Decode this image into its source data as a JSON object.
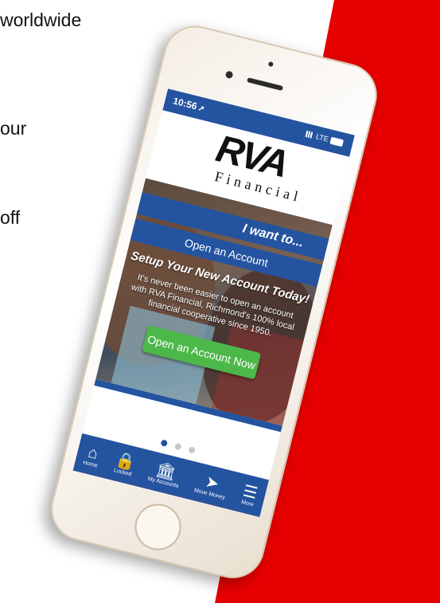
{
  "side_texts": [
    "worldwide",
    "our",
    "off"
  ],
  "status": {
    "time": "10:56",
    "nav_glyph": "➚",
    "network": "LTE"
  },
  "logo": {
    "main": "RVA",
    "sub": "Financial"
  },
  "hero": {
    "i_want_to": "I want to...",
    "option": "Open an Account",
    "title": "Setup Your New Account Today!",
    "body": "It's never been easier to open an account with RVA Financial, Richmond's 100% local financial cooperative since 1950.",
    "cta": "Open an Account Now"
  },
  "carousel": {
    "count": 3,
    "active_index": 0
  },
  "tabs": [
    {
      "label": "Home",
      "icon": "home-icon",
      "glyph": "⌂"
    },
    {
      "label": "Locked",
      "icon": "lock-icon",
      "glyph": "🔒"
    },
    {
      "label": "My Accounts",
      "icon": "bank-icon",
      "glyph": "🏛"
    },
    {
      "label": "Move Money",
      "icon": "send-icon",
      "glyph": "➤"
    },
    {
      "label": "More",
      "icon": "menu-icon",
      "glyph": "☰"
    }
  ],
  "colors": {
    "brand_blue": "#2453a0",
    "accent_red": "#e60000",
    "cta_green": "#4cb84a"
  }
}
